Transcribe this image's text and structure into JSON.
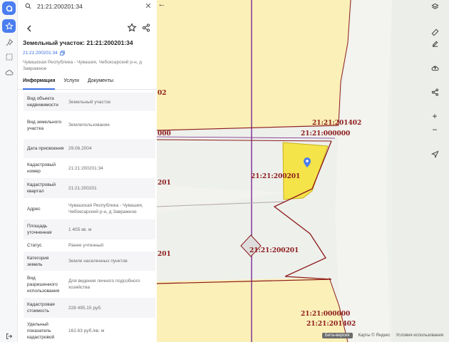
{
  "search": {
    "value": "21:21:200201:34"
  },
  "card": {
    "title": "Земельный участок: 21:21:200201:34",
    "cad_link": "21:21:200201:34",
    "address": "Чувашская Республика - Чувашия, Чебоксарский р-н, д Заврaжное"
  },
  "tabs": [
    {
      "label": "Информация",
      "active": true
    },
    {
      "label": "Услуги",
      "active": false
    },
    {
      "label": "Документы",
      "active": false
    }
  ],
  "props": [
    {
      "key": "Вид объекта недвижимости",
      "value": "Земельный участок"
    },
    {
      "key": "Вид земельного участка",
      "value": "Землепользование"
    },
    {
      "key": "Дата присвоения",
      "value": "29.06.2004"
    },
    {
      "key": "Кадастровый номер",
      "value": "21:21:200201:34"
    },
    {
      "key": "Кадастровый квартал",
      "value": "21:21:200201"
    },
    {
      "key": "Адрес",
      "value": "Чувашская Республика - Чувашия, Чебоксарский р-н, д Заврaжное"
    },
    {
      "key": "Площадь уточненная",
      "value": "1 405 кв. м"
    },
    {
      "key": "Статус",
      "value": "Ранее учтенный"
    },
    {
      "key": "Категория земель",
      "value": "Земли населенных пунктов"
    },
    {
      "key": "Вид разрешенного использования",
      "value": "Для ведения личного подсобного хозяйства"
    },
    {
      "key": "Кадастровая стоимость",
      "value": "228 495.15 руб."
    },
    {
      "key": "Удельный показатель кадастровой",
      "value": "162.63 руб./кв. м"
    }
  ],
  "map": {
    "labels": {
      "l1": "21:21:201402",
      "l2": "21:21:000000",
      "l3": "21:21:200201",
      "l4": "21:21:200201",
      "l5": "21:21:000000",
      "l6": "21:21:201402",
      "e1": "02",
      "e2": "000",
      "e3": "201",
      "e4": "201"
    },
    "attribution": {
      "beta": "Бета-версия",
      "maps": "Карты © Яндекс",
      "terms": "Условия использования"
    }
  },
  "colors": {
    "accent": "#4a7df0",
    "parcel_fill": "#fbf0b8",
    "parcel_stroke": "#8b1a1a",
    "selected_fill": "#f5e34a"
  }
}
